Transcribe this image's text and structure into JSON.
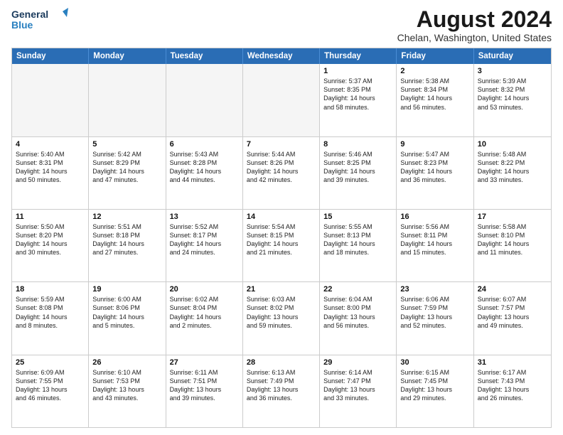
{
  "header": {
    "logo_line1": "General",
    "logo_line2": "Blue",
    "month_year": "August 2024",
    "location": "Chelan, Washington, United States"
  },
  "weekdays": [
    "Sunday",
    "Monday",
    "Tuesday",
    "Wednesday",
    "Thursday",
    "Friday",
    "Saturday"
  ],
  "weeks": [
    [
      {
        "day": "",
        "text": "",
        "empty": true
      },
      {
        "day": "",
        "text": "",
        "empty": true
      },
      {
        "day": "",
        "text": "",
        "empty": true
      },
      {
        "day": "",
        "text": "",
        "empty": true
      },
      {
        "day": "1",
        "text": "Sunrise: 5:37 AM\nSunset: 8:35 PM\nDaylight: 14 hours\nand 58 minutes.",
        "empty": false
      },
      {
        "day": "2",
        "text": "Sunrise: 5:38 AM\nSunset: 8:34 PM\nDaylight: 14 hours\nand 56 minutes.",
        "empty": false
      },
      {
        "day": "3",
        "text": "Sunrise: 5:39 AM\nSunset: 8:32 PM\nDaylight: 14 hours\nand 53 minutes.",
        "empty": false
      }
    ],
    [
      {
        "day": "4",
        "text": "Sunrise: 5:40 AM\nSunset: 8:31 PM\nDaylight: 14 hours\nand 50 minutes.",
        "empty": false
      },
      {
        "day": "5",
        "text": "Sunrise: 5:42 AM\nSunset: 8:29 PM\nDaylight: 14 hours\nand 47 minutes.",
        "empty": false
      },
      {
        "day": "6",
        "text": "Sunrise: 5:43 AM\nSunset: 8:28 PM\nDaylight: 14 hours\nand 44 minutes.",
        "empty": false
      },
      {
        "day": "7",
        "text": "Sunrise: 5:44 AM\nSunset: 8:26 PM\nDaylight: 14 hours\nand 42 minutes.",
        "empty": false
      },
      {
        "day": "8",
        "text": "Sunrise: 5:46 AM\nSunset: 8:25 PM\nDaylight: 14 hours\nand 39 minutes.",
        "empty": false
      },
      {
        "day": "9",
        "text": "Sunrise: 5:47 AM\nSunset: 8:23 PM\nDaylight: 14 hours\nand 36 minutes.",
        "empty": false
      },
      {
        "day": "10",
        "text": "Sunrise: 5:48 AM\nSunset: 8:22 PM\nDaylight: 14 hours\nand 33 minutes.",
        "empty": false
      }
    ],
    [
      {
        "day": "11",
        "text": "Sunrise: 5:50 AM\nSunset: 8:20 PM\nDaylight: 14 hours\nand 30 minutes.",
        "empty": false
      },
      {
        "day": "12",
        "text": "Sunrise: 5:51 AM\nSunset: 8:18 PM\nDaylight: 14 hours\nand 27 minutes.",
        "empty": false
      },
      {
        "day": "13",
        "text": "Sunrise: 5:52 AM\nSunset: 8:17 PM\nDaylight: 14 hours\nand 24 minutes.",
        "empty": false
      },
      {
        "day": "14",
        "text": "Sunrise: 5:54 AM\nSunset: 8:15 PM\nDaylight: 14 hours\nand 21 minutes.",
        "empty": false
      },
      {
        "day": "15",
        "text": "Sunrise: 5:55 AM\nSunset: 8:13 PM\nDaylight: 14 hours\nand 18 minutes.",
        "empty": false
      },
      {
        "day": "16",
        "text": "Sunrise: 5:56 AM\nSunset: 8:11 PM\nDaylight: 14 hours\nand 15 minutes.",
        "empty": false
      },
      {
        "day": "17",
        "text": "Sunrise: 5:58 AM\nSunset: 8:10 PM\nDaylight: 14 hours\nand 11 minutes.",
        "empty": false
      }
    ],
    [
      {
        "day": "18",
        "text": "Sunrise: 5:59 AM\nSunset: 8:08 PM\nDaylight: 14 hours\nand 8 minutes.",
        "empty": false
      },
      {
        "day": "19",
        "text": "Sunrise: 6:00 AM\nSunset: 8:06 PM\nDaylight: 14 hours\nand 5 minutes.",
        "empty": false
      },
      {
        "day": "20",
        "text": "Sunrise: 6:02 AM\nSunset: 8:04 PM\nDaylight: 14 hours\nand 2 minutes.",
        "empty": false
      },
      {
        "day": "21",
        "text": "Sunrise: 6:03 AM\nSunset: 8:02 PM\nDaylight: 13 hours\nand 59 minutes.",
        "empty": false
      },
      {
        "day": "22",
        "text": "Sunrise: 6:04 AM\nSunset: 8:00 PM\nDaylight: 13 hours\nand 56 minutes.",
        "empty": false
      },
      {
        "day": "23",
        "text": "Sunrise: 6:06 AM\nSunset: 7:59 PM\nDaylight: 13 hours\nand 52 minutes.",
        "empty": false
      },
      {
        "day": "24",
        "text": "Sunrise: 6:07 AM\nSunset: 7:57 PM\nDaylight: 13 hours\nand 49 minutes.",
        "empty": false
      }
    ],
    [
      {
        "day": "25",
        "text": "Sunrise: 6:09 AM\nSunset: 7:55 PM\nDaylight: 13 hours\nand 46 minutes.",
        "empty": false
      },
      {
        "day": "26",
        "text": "Sunrise: 6:10 AM\nSunset: 7:53 PM\nDaylight: 13 hours\nand 43 minutes.",
        "empty": false
      },
      {
        "day": "27",
        "text": "Sunrise: 6:11 AM\nSunset: 7:51 PM\nDaylight: 13 hours\nand 39 minutes.",
        "empty": false
      },
      {
        "day": "28",
        "text": "Sunrise: 6:13 AM\nSunset: 7:49 PM\nDaylight: 13 hours\nand 36 minutes.",
        "empty": false
      },
      {
        "day": "29",
        "text": "Sunrise: 6:14 AM\nSunset: 7:47 PM\nDaylight: 13 hours\nand 33 minutes.",
        "empty": false
      },
      {
        "day": "30",
        "text": "Sunrise: 6:15 AM\nSunset: 7:45 PM\nDaylight: 13 hours\nand 29 minutes.",
        "empty": false
      },
      {
        "day": "31",
        "text": "Sunrise: 6:17 AM\nSunset: 7:43 PM\nDaylight: 13 hours\nand 26 minutes.",
        "empty": false
      }
    ]
  ]
}
